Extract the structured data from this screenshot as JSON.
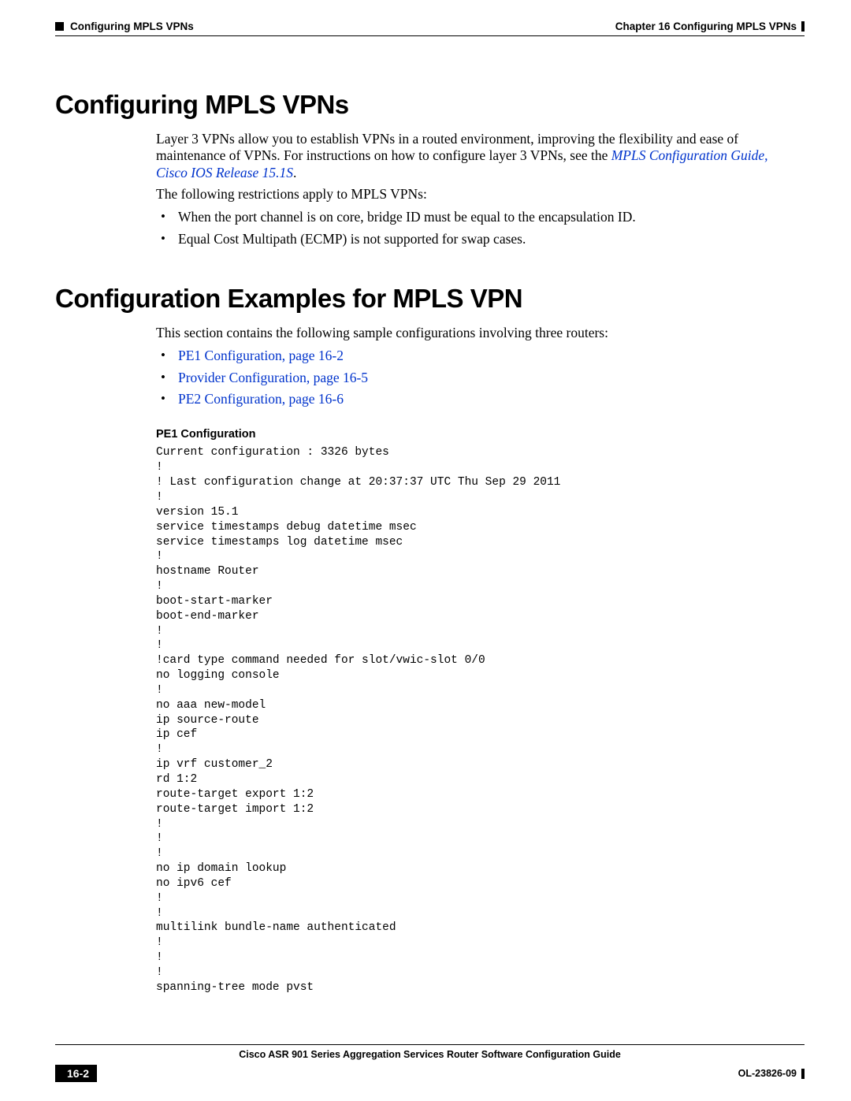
{
  "header": {
    "left_section": "Configuring MPLS VPNs",
    "right_chapter": "Chapter 16    Configuring MPLS VPNs"
  },
  "section1": {
    "title": "Configuring MPLS VPNs",
    "para1_a": "Layer 3 VPNs allow you to establish VPNs in a routed environment, improving the flexibility and ease of maintenance of VPNs. For instructions on how to configure layer 3 VPNs, see the ",
    "link": "MPLS Configuration Guide, Cisco IOS Release 15.1S",
    "para1_b": ".",
    "para2": "The following restrictions apply to MPLS VPNs:",
    "bullets": [
      "When the port channel is on core, bridge ID must be equal to the encapsulation ID.",
      "Equal Cost Multipath (ECMP) is not supported for swap cases."
    ]
  },
  "section2": {
    "title": "Configuration Examples for MPLS VPN",
    "para1": "This section contains the following sample configurations involving three routers:",
    "links": [
      "PE1 Configuration, page 16-2",
      "Provider Configuration, page 16-5",
      "PE2 Configuration, page 16-6"
    ]
  },
  "pe1": {
    "heading": "PE1 Configuration",
    "config": "Current configuration : 3326 bytes\n!\n! Last configuration change at 20:37:37 UTC Thu Sep 29 2011\n!\nversion 15.1\nservice timestamps debug datetime msec\nservice timestamps log datetime msec\n!\nhostname Router\n!\nboot-start-marker\nboot-end-marker\n!\n!\n!card type command needed for slot/vwic-slot 0/0\nno logging console\n!\nno aaa new-model\nip source-route\nip cef\n!\nip vrf customer_2\nrd 1:2\nroute-target export 1:2\nroute-target import 1:2\n!\n!\n!\nno ip domain lookup\nno ipv6 cef\n!\n!\nmultilink bundle-name authenticated\n!\n!\n!\nspanning-tree mode pvst"
  },
  "footer": {
    "guide_title": "Cisco ASR 901 Series Aggregation Services Router Software Configuration Guide",
    "page_num": "16-2",
    "doc_id": "OL-23826-09"
  }
}
